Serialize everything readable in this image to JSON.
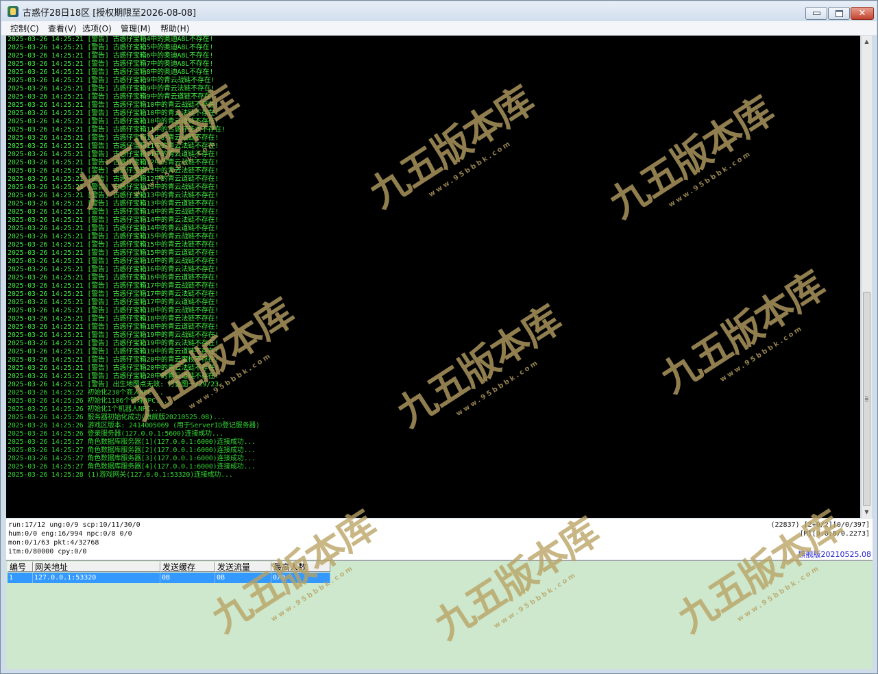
{
  "window": {
    "title": "古惑仔28日18区 [授权期限至2026-08-08]",
    "icon": "app-icon",
    "controls": {
      "minimize": "minimize-icon",
      "maximize": "maximize-icon",
      "close": "close-icon",
      "close_glyph": "✕"
    }
  },
  "menu": [
    "控制(C)",
    "查看(V)",
    "选项(O)",
    "管理(M)",
    "帮助(H)"
  ],
  "log": [
    {
      "t": "2025-03-26 14:25:21",
      "m": "[警告] 古惑仔宝箱4中的奥迪A8L不存在!",
      "k": "warn"
    },
    {
      "t": "2025-03-26 14:25:21",
      "m": "[警告] 古惑仔宝箱5中的奥迪A8L不存在!",
      "k": "warn"
    },
    {
      "t": "2025-03-26 14:25:21",
      "m": "[警告] 古惑仔宝箱6中的奥迪A8L不存在!",
      "k": "warn"
    },
    {
      "t": "2025-03-26 14:25:21",
      "m": "[警告] 古惑仔宝箱7中的奥迪A8L不存在!",
      "k": "warn"
    },
    {
      "t": "2025-03-26 14:25:21",
      "m": "[警告] 古惑仔宝箱8中的奥迪A8L不存在!",
      "k": "warn"
    },
    {
      "t": "2025-03-26 14:25:21",
      "m": "[警告] 古惑仔宝箱9中的青云战链不存在!",
      "k": "warn"
    },
    {
      "t": "2025-03-26 14:25:21",
      "m": "[警告] 古惑仔宝箱9中的青云法链不存在!",
      "k": "warn"
    },
    {
      "t": "2025-03-26 14:25:21",
      "m": "[警告] 古惑仔宝箱9中的青云道链不存在!",
      "k": "warn"
    },
    {
      "t": "2025-03-26 14:25:21",
      "m": "[警告] 古惑仔宝箱10中的青云战链不存在!",
      "k": "warn"
    },
    {
      "t": "2025-03-26 14:25:21",
      "m": "[警告] 古惑仔宝箱10中的青云法链不存在!",
      "k": "warn"
    },
    {
      "t": "2025-03-26 14:25:21",
      "m": "[警告] 古惑仔宝箱10中的青云道链不存在!",
      "k": "warn"
    },
    {
      "t": "2025-03-26 14:25:21",
      "m": "[警告] 古惑仔宝箱11中的古惑仔圣衣不存在!",
      "k": "warn"
    },
    {
      "t": "2025-03-26 14:25:21",
      "m": "[警告] 古惑仔宝箱11中的青云战链不存在!",
      "k": "warn"
    },
    {
      "t": "2025-03-26 14:25:21",
      "m": "[警告] 古惑仔宝箱11中的青云法链不存在!",
      "k": "warn"
    },
    {
      "t": "2025-03-26 14:25:21",
      "m": "[警告] 古惑仔宝箱11中的青云道链不存在!",
      "k": "warn"
    },
    {
      "t": "2025-03-26 14:25:21",
      "m": "[警告] 古惑仔宝箱12中的青云战链不存在!",
      "k": "warn"
    },
    {
      "t": "2025-03-26 14:25:21",
      "m": "[警告] 古惑仔宝箱12中的青云法链不存在!",
      "k": "warn"
    },
    {
      "t": "2025-03-26 14:25:21",
      "m": "[警告] 古惑仔宝箱12中的青云道链不存在!",
      "k": "warn"
    },
    {
      "t": "2025-03-26 14:25:21",
      "m": "[警告] 古惑仔宝箱13中的青云战链不存在!",
      "k": "warn"
    },
    {
      "t": "2025-03-26 14:25:21",
      "m": "[警告] 古惑仔宝箱13中的青云法链不存在!",
      "k": "warn"
    },
    {
      "t": "2025-03-26 14:25:21",
      "m": "[警告] 古惑仔宝箱13中的青云道链不存在!",
      "k": "warn"
    },
    {
      "t": "2025-03-26 14:25:21",
      "m": "[警告] 古惑仔宝箱14中的青云战链不存在!",
      "k": "warn"
    },
    {
      "t": "2025-03-26 14:25:21",
      "m": "[警告] 古惑仔宝箱14中的青云法链不存在!",
      "k": "warn"
    },
    {
      "t": "2025-03-26 14:25:21",
      "m": "[警告] 古惑仔宝箱14中的青云道链不存在!",
      "k": "warn"
    },
    {
      "t": "2025-03-26 14:25:21",
      "m": "[警告] 古惑仔宝箱15中的青云战链不存在!",
      "k": "warn"
    },
    {
      "t": "2025-03-26 14:25:21",
      "m": "[警告] 古惑仔宝箱15中的青云法链不存在!",
      "k": "warn"
    },
    {
      "t": "2025-03-26 14:25:21",
      "m": "[警告] 古惑仔宝箱15中的青云道链不存在!",
      "k": "warn"
    },
    {
      "t": "2025-03-26 14:25:21",
      "m": "[警告] 古惑仔宝箱16中的青云战链不存在!",
      "k": "warn"
    },
    {
      "t": "2025-03-26 14:25:21",
      "m": "[警告] 古惑仔宝箱16中的青云法链不存在!",
      "k": "warn"
    },
    {
      "t": "2025-03-26 14:25:21",
      "m": "[警告] 古惑仔宝箱16中的青云道链不存在!",
      "k": "warn"
    },
    {
      "t": "2025-03-26 14:25:21",
      "m": "[警告] 古惑仔宝箱17中的青云战链不存在!",
      "k": "warn"
    },
    {
      "t": "2025-03-26 14:25:21",
      "m": "[警告] 古惑仔宝箱17中的青云法链不存在!",
      "k": "warn"
    },
    {
      "t": "2025-03-26 14:25:21",
      "m": "[警告] 古惑仔宝箱17中的青云道链不存在!",
      "k": "warn"
    },
    {
      "t": "2025-03-26 14:25:21",
      "m": "[警告] 古惑仔宝箱18中的青云战链不存在!",
      "k": "warn"
    },
    {
      "t": "2025-03-26 14:25:21",
      "m": "[警告] 古惑仔宝箱18中的青云法链不存在!",
      "k": "warn"
    },
    {
      "t": "2025-03-26 14:25:21",
      "m": "[警告] 古惑仔宝箱18中的青云道链不存在!",
      "k": "warn"
    },
    {
      "t": "2025-03-26 14:25:21",
      "m": "[警告] 古惑仔宝箱19中的青云战链不存在!",
      "k": "warn"
    },
    {
      "t": "2025-03-26 14:25:21",
      "m": "[警告] 古惑仔宝箱19中的青云法链不存在!",
      "k": "warn"
    },
    {
      "t": "2025-03-26 14:25:21",
      "m": "[警告] 古惑仔宝箱19中的青云道链不存在!",
      "k": "warn"
    },
    {
      "t": "2025-03-26 14:25:21",
      "m": "[警告] 古惑仔宝箱20中的青云魔杖不存在!",
      "k": "warn"
    },
    {
      "t": "2025-03-26 14:25:21",
      "m": "[警告] 古惑仔宝箱20中的青云法链不存在!",
      "k": "warn"
    },
    {
      "t": "2025-03-26 14:25:21",
      "m": "[警告] 古惑仔宝箱20中的青云道链不存在!",
      "k": "warn"
    },
    {
      "t": "2025-03-26 14:25:21",
      "m": "[警告] 出生地图点无效: 行会图一/29/23",
      "k": "warn"
    },
    {
      "t": "2025-03-26 14:25:22",
      "m": "初始化230个商人NPC...",
      "k": "info"
    },
    {
      "t": "2025-03-26 14:25:26",
      "m": "初始化1106个管理NPC...",
      "k": "info"
    },
    {
      "t": "2025-03-26 14:25:26",
      "m": "初始化1个机器人NPC...",
      "k": "info"
    },
    {
      "t": "2025-03-26 14:25:26",
      "m": "服务器初始化成功(旗舰版20210525.08)...",
      "k": "info"
    },
    {
      "t": "2025-03-26 14:25:26",
      "m": "游戏区版本: 2414005069 (用于ServerID登记服务器)",
      "k": "info"
    },
    {
      "t": "2025-03-26 14:25:26",
      "m": "登录服务器(127.0.0.1:5600)连接成功...",
      "k": "info"
    },
    {
      "t": "2025-03-26 14:25:27",
      "m": "角色数据库服务器[1](127.0.0.1:6000)连接成功...",
      "k": "info"
    },
    {
      "t": "2025-03-26 14:25:27",
      "m": "角色数据库服务器[2](127.0.0.1:6000)连接成功...",
      "k": "info"
    },
    {
      "t": "2025-03-26 14:25:27",
      "m": "角色数据库服务器[3](127.0.0.1:6000)连接成功...",
      "k": "info"
    },
    {
      "t": "2025-03-26 14:25:27",
      "m": "角色数据库服务器[4](127.0.0.1:6000)连接成功...",
      "k": "info"
    },
    {
      "t": "2025-03-26 14:25:28",
      "m": "(1)游戏网关(127.0.0.1:53320)连接成功...",
      "k": "info"
    }
  ],
  "scrollbar": {
    "up": "▲",
    "down": "▼"
  },
  "status": {
    "left": [
      "run:17/12 ung:0/9 scp:10/11/30/0",
      "hum:0/0 eng:16/994 npc:0/0 0/0",
      "mon:0/1/63 pkt:4/32768",
      "itm:0/80000 cpy:0/0"
    ],
    "right": [
      "(22837) [2+0/2][0/0/397]",
      "[M][0:0:0/0.2273]"
    ],
    "version": "旗舰版20210525.08",
    "version_color": "#1b1bd0"
  },
  "grid": {
    "headers": [
      "编号",
      "网关地址",
      "发送缓存",
      "发送流量",
      "最高人数"
    ],
    "rows": [
      [
        "1",
        "127.0.0.1:53320",
        "0B",
        "0B",
        "0/0"
      ]
    ],
    "selected_color": "#3399ff",
    "background": "#cde8cd"
  },
  "watermark": {
    "main": "九五版本库",
    "sub": "www.95bbbk.com"
  }
}
